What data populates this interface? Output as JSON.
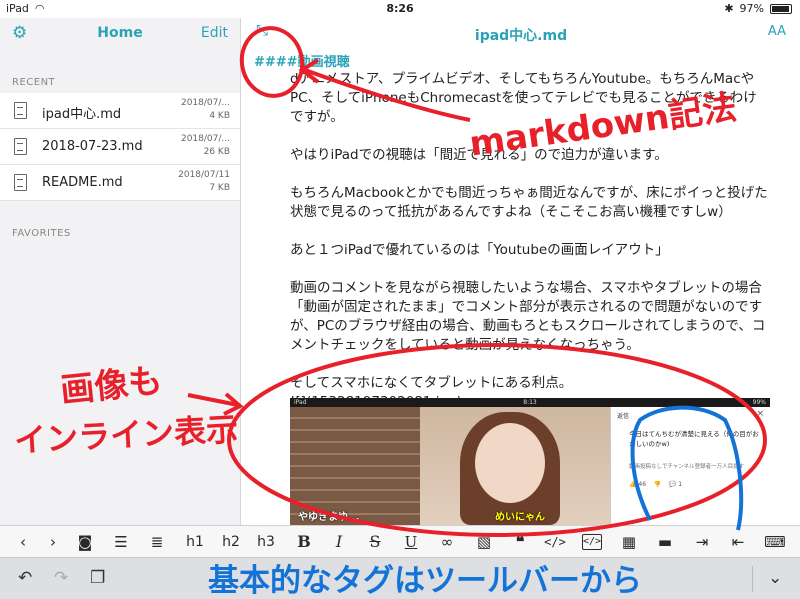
{
  "statusbar": {
    "device": "iPad",
    "time": "8:26",
    "battery": "97%"
  },
  "sidebar": {
    "title": "Home",
    "edit_label": "Edit",
    "recent_label": "RECENT",
    "favorites_label": "FAVORITES",
    "files": [
      {
        "name": "ipad中心.md",
        "date": "2018/07/...",
        "size": "4 KB"
      },
      {
        "name": "2018-07-23.md",
        "date": "2018/07/...",
        "size": "26 KB"
      },
      {
        "name": "README.md",
        "date": "2018/07/11",
        "size": "7 KB"
      }
    ]
  },
  "editor": {
    "title": "ipad中心.md",
    "font_size_label": "AA",
    "heading": "####動画視聴",
    "paragraphs": [
      "dアニメストア、プライムビデオ、そしてもちろんYoutube。もちろんMacやPC、そしてiPhoneもChromecastを使ってテレビでも見ることができるわけですが。",
      "やはりiPadでの視聴は「間近で見れる」ので迫力が違います。",
      "もちろんMacbookとかでも間近っちゃぁ間近なんですが、床にポイっと投げた状態で見るのって抵抗があるんですよね（そこそこお高い機種ですしw）",
      "あと１つiPadで優れているのは「Youtubeの画面レイアウト」",
      "動画のコメントを見ながら視聴したいような場合、スマホやタブレットの場合「動画が固定されたまま」でコメント部分が表示されるので問題がないのですが、PCのブラウザ経由の場合、動画もろともスクロールされてしまうので、コメントチェックをしていると動画が見えなくなっちゃう。",
      "そしてスマホになくてタブレットにある利点。"
    ],
    "image_markdown": "![](15328197302081.jpg)"
  },
  "inline_image": {
    "device": "iPad",
    "time": "8:13",
    "battery": "99%",
    "panel_header": "返信",
    "comment": "今日はてんちむが清楚に見える（俺の目がおかしいのかw)",
    "reply_note": "動画投稿なしでチャンネル登録者一万人目指す",
    "likes": "46",
    "replies": "1",
    "subtitle_left": "やゆきまゆ...",
    "subtitle_right": "めいにゃん"
  },
  "toolbar": {
    "h1": "h1",
    "h2": "h2",
    "h3": "h3",
    "bold": "B",
    "italic": "I",
    "strike": "S",
    "underline": "U",
    "code": "</>",
    "codeblock": "</>"
  },
  "annotations": {
    "markdown_note": "markdown記法",
    "image_note_line1": "画像も",
    "image_note_line2": "インライン表示",
    "toolbar_note": "基本的なタグはツールバーから"
  },
  "colors": {
    "accent": "#2aa3b8",
    "annotation_red": "#e8202a",
    "annotation_blue": "#1473d6"
  }
}
